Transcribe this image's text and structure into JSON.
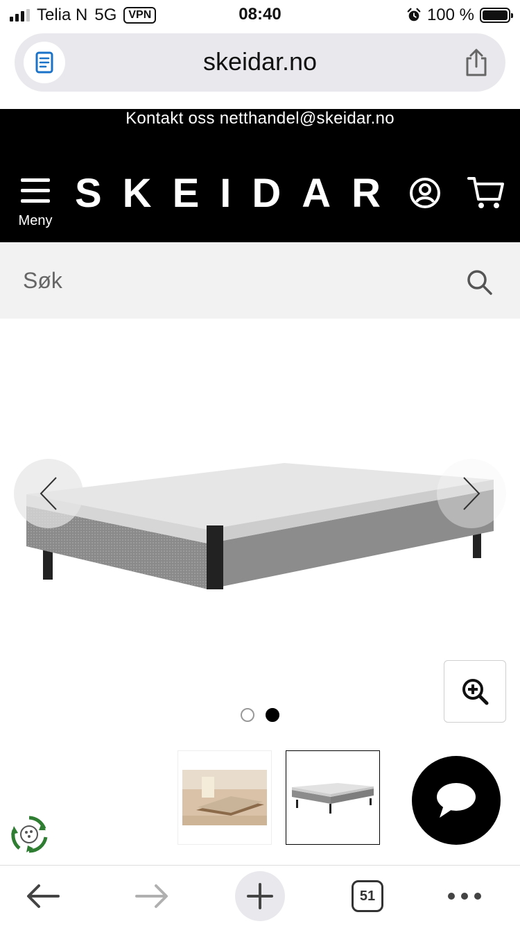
{
  "status_bar": {
    "carrier": "Telia N",
    "network": "5G",
    "vpn": "VPN",
    "time": "08:40",
    "battery": "100 %"
  },
  "browser": {
    "url": "skeidar.no"
  },
  "header": {
    "contact": "Kontakt oss netthandel@skeidar.no",
    "logo": "SKEIDAR",
    "menu_label": "Meny"
  },
  "search": {
    "placeholder": "Søk"
  },
  "carousel": {
    "slide_count": 2,
    "active_index": 1
  },
  "toolbar": {
    "tabs_count": "51"
  },
  "colors": {
    "header_bg": "#000000",
    "search_bg": "#f2f2f2",
    "url_bar_bg": "#e9e9ed",
    "eco_green": "#2e7d32"
  }
}
